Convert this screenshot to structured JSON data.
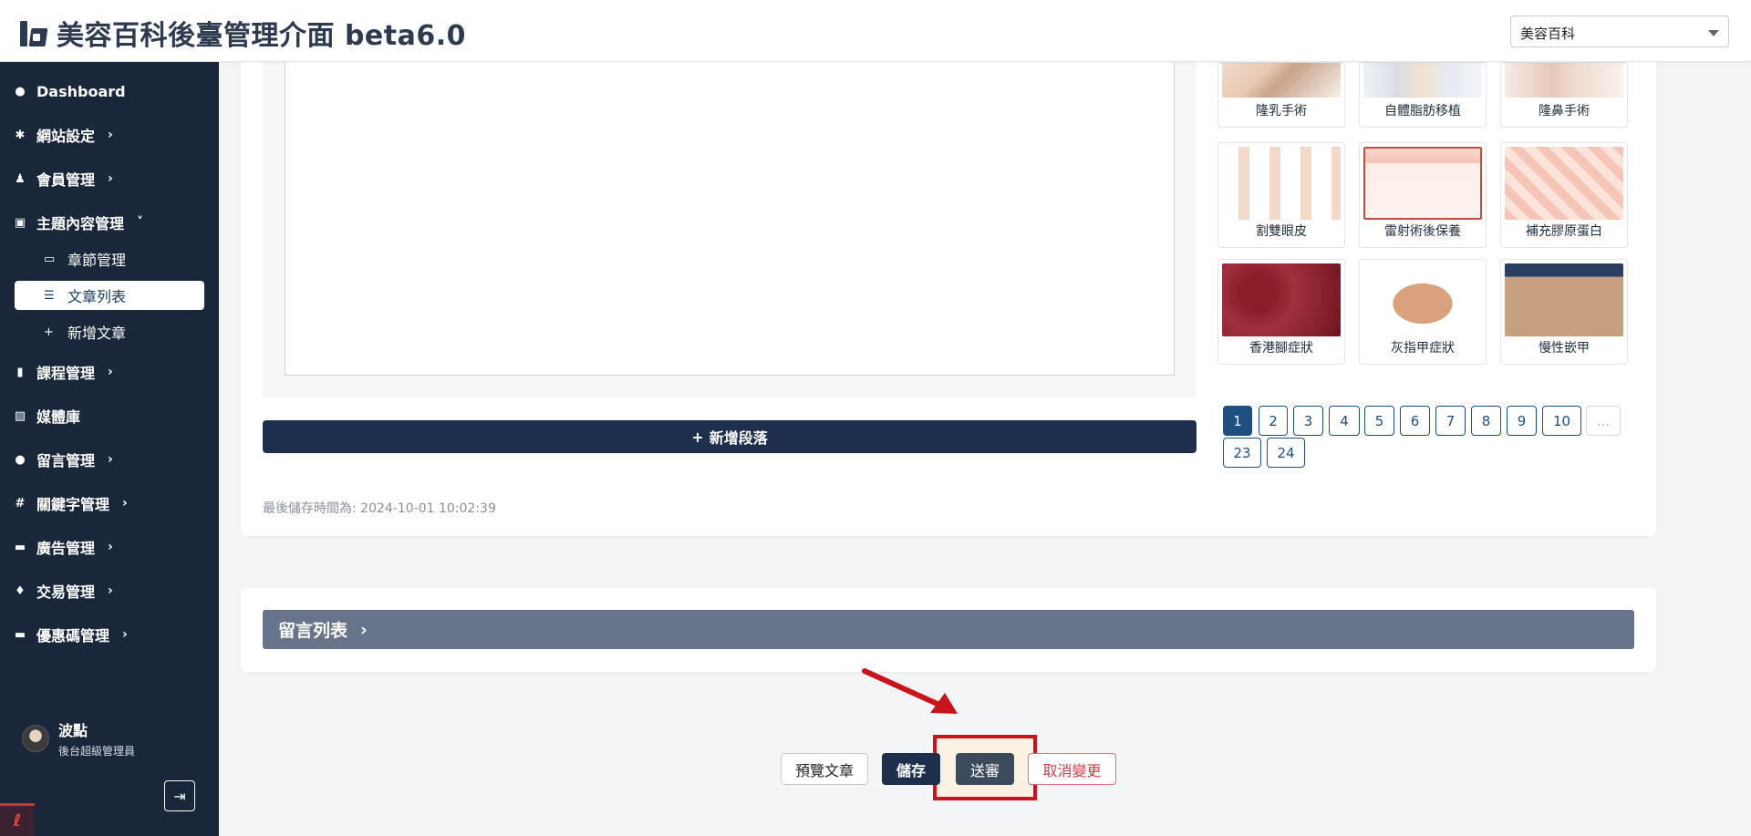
{
  "header": {
    "title": "美容百科後臺管理介面 beta6.0",
    "site_selector": "美容百科"
  },
  "sidebar": {
    "items": [
      {
        "label": "Dashboard",
        "icon": "palette-icon"
      },
      {
        "label": "網站設定",
        "icon": "gear-icon"
      },
      {
        "label": "會員管理",
        "icon": "users-icon"
      },
      {
        "label": "主題內容管理",
        "icon": "book-icon"
      },
      {
        "label": "課程管理",
        "icon": "course-icon"
      },
      {
        "label": "媒體庫",
        "icon": "images-icon"
      },
      {
        "label": "留言管理",
        "icon": "comment-icon"
      },
      {
        "label": "關鍵字管理",
        "icon": "hashtag-icon"
      },
      {
        "label": "廣告管理",
        "icon": "ad-icon"
      },
      {
        "label": "交易管理",
        "icon": "money-bag-icon"
      },
      {
        "label": "優惠碼管理",
        "icon": "ticket-icon"
      }
    ],
    "subitems": [
      {
        "label": "章節管理",
        "icon": "chapter-icon"
      },
      {
        "label": "文章列表",
        "icon": "list-icon"
      },
      {
        "label": "新增文章",
        "icon": "plus-icon"
      }
    ],
    "user": {
      "name": "波點",
      "role": "後台超級管理員"
    }
  },
  "editor": {
    "add_paragraph": "新增段落",
    "last_saved": "最後儲存時間為: 2024-10-01 10:02:39"
  },
  "gallery": {
    "images": [
      {
        "caption": "隆乳手術"
      },
      {
        "caption": "自體脂肪移植"
      },
      {
        "caption": "隆鼻手術"
      },
      {
        "caption": "割雙眼皮"
      },
      {
        "caption": "雷射術後保養"
      },
      {
        "caption": "補充膠原蛋白"
      },
      {
        "caption": "香港腳症狀"
      },
      {
        "caption": "灰指甲症狀"
      },
      {
        "caption": "慢性嵌甲"
      }
    ],
    "pages": [
      "1",
      "2",
      "3",
      "4",
      "5",
      "6",
      "7",
      "8",
      "9",
      "10",
      "...",
      "23",
      "24"
    ],
    "active_page": "1"
  },
  "comments": {
    "title": "留言列表"
  },
  "actions": {
    "preview": "預覽文章",
    "save": "儲存",
    "submit_review": "送審",
    "cancel": "取消變更"
  },
  "colors": {
    "sidebar_bg": "#1a273a",
    "primary": "#1d2f4d",
    "accent_red": "#c8141c"
  }
}
